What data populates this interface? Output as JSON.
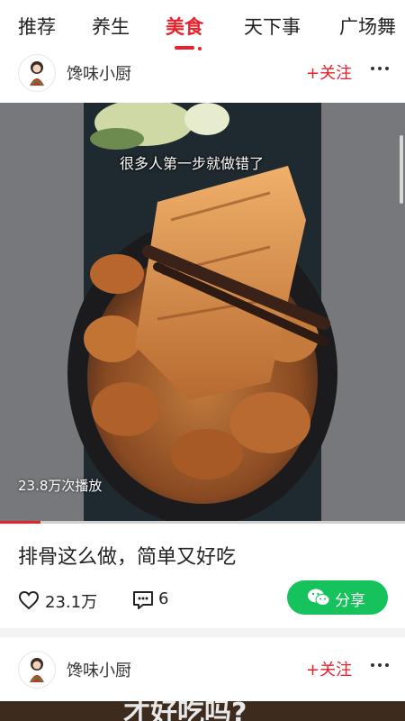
{
  "tabs": [
    {
      "label": "推荐"
    },
    {
      "label": "养生"
    },
    {
      "label": "美食",
      "active": true
    },
    {
      "label": "天下事"
    },
    {
      "label": "广场舞"
    }
  ],
  "colors": {
    "accent": "#e8202a",
    "share_green": "#16c25c"
  },
  "posts": [
    {
      "author": "馋味小厨",
      "follow_label": "+关注",
      "video_caption": "很多人第一步就做错了",
      "play_count": "23.8万次播放",
      "progress": 0.1,
      "title": "排骨这么做，简单又好吃",
      "likes": "23.1万",
      "comments": "6",
      "share_label": "分享"
    },
    {
      "author": "馋味小厨",
      "follow_label": "+关注",
      "video_caption": "才好吃吗?"
    }
  ],
  "icons": [
    "more-icon",
    "heart-icon",
    "comment-icon",
    "wechat-icon"
  ]
}
